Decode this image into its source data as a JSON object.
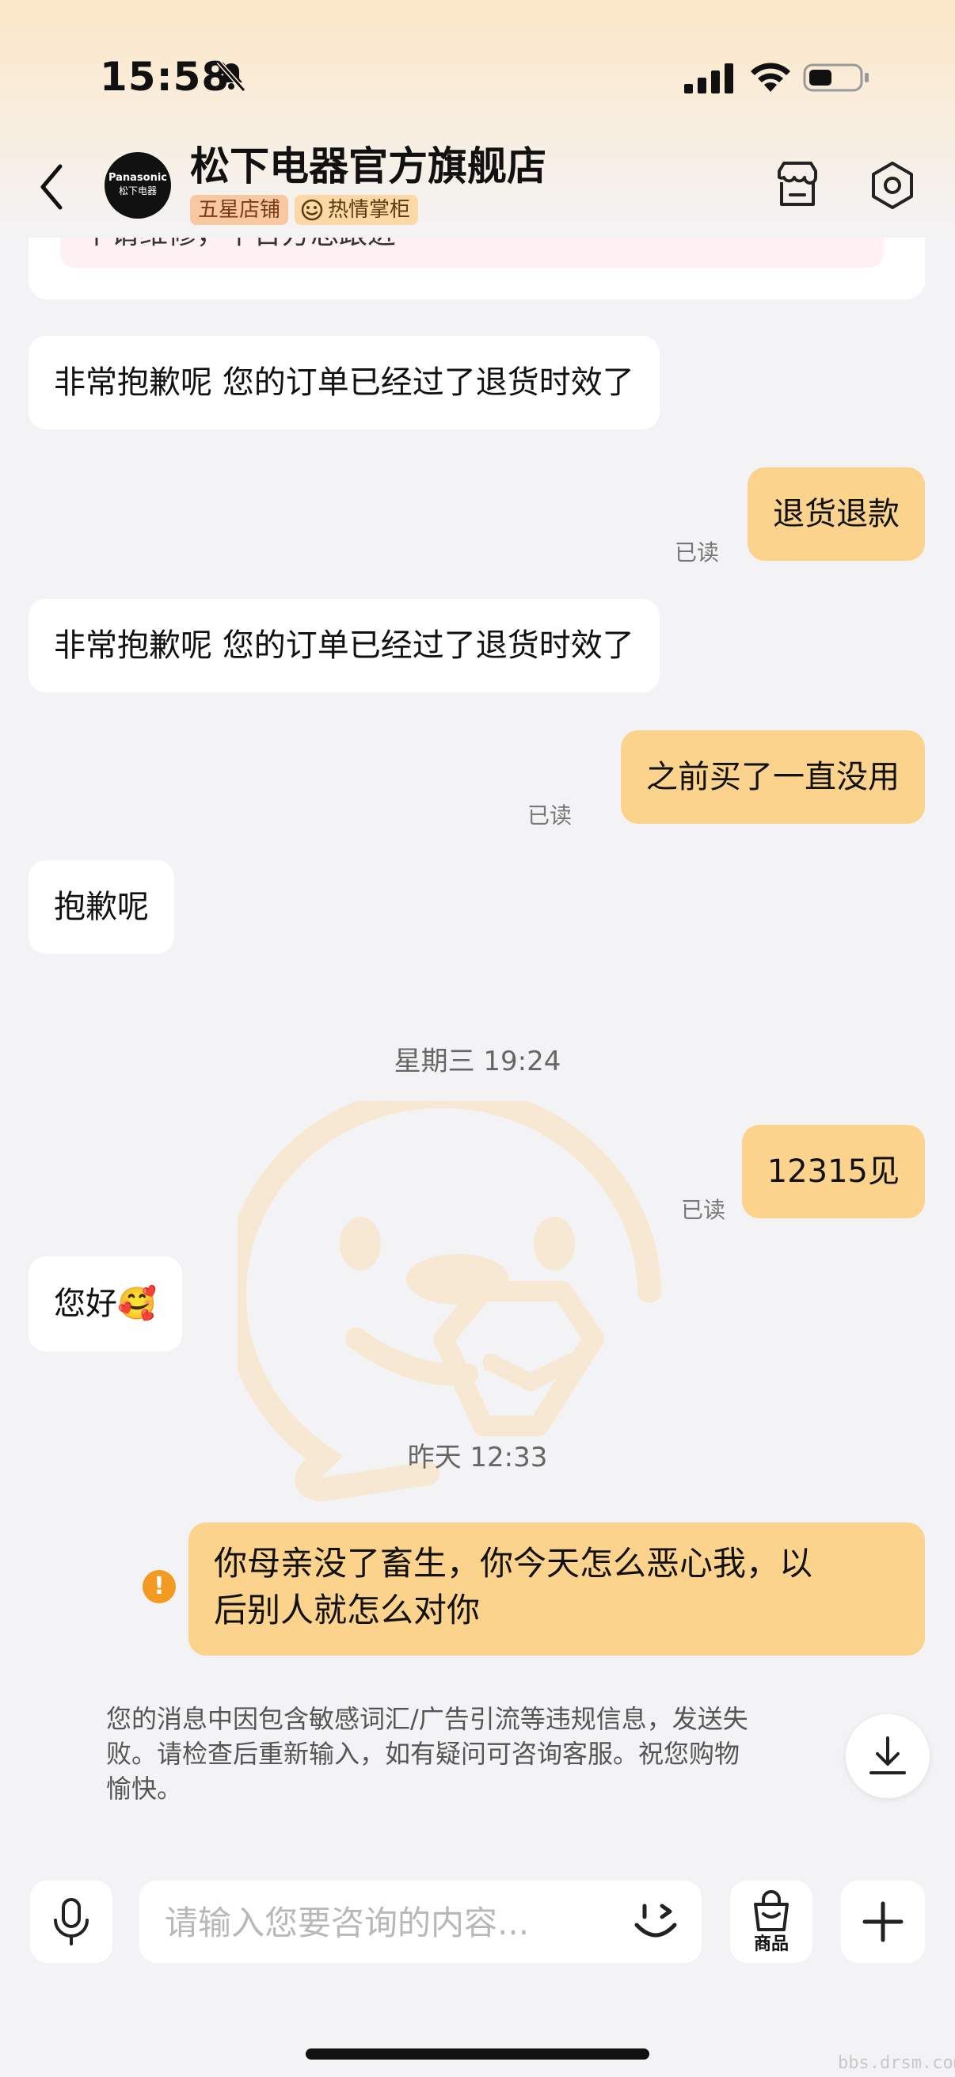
{
  "status_bar": {
    "time": "15:58"
  },
  "header": {
    "shop_name": "松下电器官方旗舰店",
    "avatar_line1": "Panasonic",
    "avatar_line2": "松下电器",
    "badge_rating": "五星店铺",
    "badge_keeper": "热情掌柜"
  },
  "previous_card_partial_text": "个请维修，平台方总跟进",
  "messages": [
    {
      "side": "in",
      "text": "非常抱歉呢 您的订单已经过了退货时效了"
    },
    {
      "side": "out",
      "text": "退货退款",
      "read": "已读"
    },
    {
      "side": "in",
      "text": "非常抱歉呢 您的订单已经过了退货时效了"
    },
    {
      "side": "out",
      "text": "之前买了一直没用",
      "read": "已读"
    },
    {
      "side": "in",
      "text": "抱歉呢"
    },
    {
      "side": "time",
      "text": "星期三 19:24"
    },
    {
      "side": "out",
      "text": "12315见",
      "read": "已读"
    },
    {
      "side": "in",
      "text": "您好🥰"
    },
    {
      "side": "time",
      "text": "昨天 12:33"
    }
  ],
  "failed_message": {
    "line1": "你母亲没了畜生，你今天怎么恶心我，以",
    "line2": "后别人就怎么对你",
    "warning_symbol": "!"
  },
  "fail_notice": {
    "line1": "您的消息中因包含敏感词汇/广告引流等违规信息，发送失",
    "line2": "败。请检查后重新输入，如有疑问可咨询客服。祝您购物",
    "line3": "愉快。"
  },
  "input_bar": {
    "placeholder": "请输入您要咨询的内容...",
    "goods_label": "商品"
  },
  "site_watermark": "bbs.drsm.com",
  "colors": {
    "out_bubble": "#fbd38c",
    "in_bubble": "#ffffff",
    "warning": "#f39a22"
  }
}
